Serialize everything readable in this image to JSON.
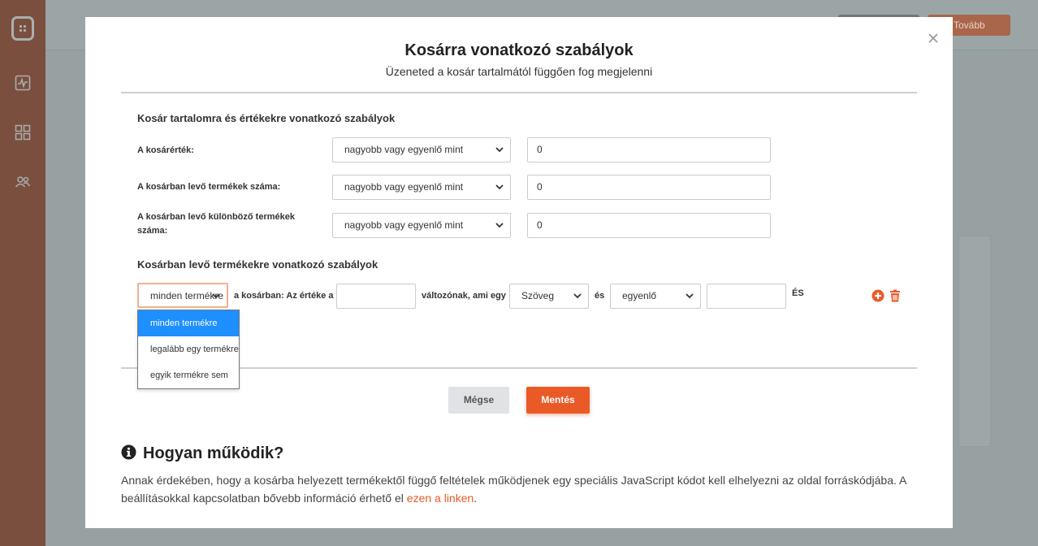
{
  "background": {
    "continue_button": "Tovább"
  },
  "modal": {
    "title": "Kosárra vonatkozó szabályok",
    "subtitle": "Üzeneted a kosár tartalmától függően fog megjelenni",
    "section1": {
      "title": "Kosár tartalomra és értékekre vonatkozó szabályok",
      "rows": [
        {
          "label": "A kosárérték:",
          "operator": "nagyobb vagy egyenlő mint",
          "value": "0"
        },
        {
          "label": "A kosárban levő termékek száma:",
          "operator": "nagyobb vagy egyenlő mint",
          "value": "0"
        },
        {
          "label_line1": "A kosárban levő különböző termékek",
          "label_line2": "száma:",
          "operator": "nagyobb vagy egyenlő mint",
          "value": "0"
        }
      ]
    },
    "section2": {
      "title": "Kosárban levő termékekre vonatkozó szabályok",
      "rule": {
        "scope_select": "minden termékre",
        "text1": "a kosárban: Az értéke a",
        "variable_value": "",
        "text2": "változónak, ami egy",
        "type_select": "Szöveg",
        "text3": "és",
        "compare_select": "egyenlő",
        "compare_value": "",
        "text4": "ÉS"
      },
      "dropdown_options": [
        "minden termékre",
        "legalább egy termékre",
        "egyik termékre sem"
      ],
      "dropdown_selected_index": 0
    },
    "buttons": {
      "cancel": "Mégse",
      "save": "Mentés"
    },
    "how": {
      "title": "Hogyan működik?",
      "text": "Annak érdekében, hogy a kosárba helyezett termékektől függő feltételek működjenek egy speciális JavaScript kódot kell elhelyezni az oldal forráskódjába. A beállításokkal kapcsolatban bővebb információ érhető el",
      "link_text": "ezen a linken",
      "suffix": "."
    }
  },
  "colors": {
    "accent": "#ea5a27",
    "dropdown_selected": "#1e8fff",
    "sidebar": "#7a4f3e"
  }
}
